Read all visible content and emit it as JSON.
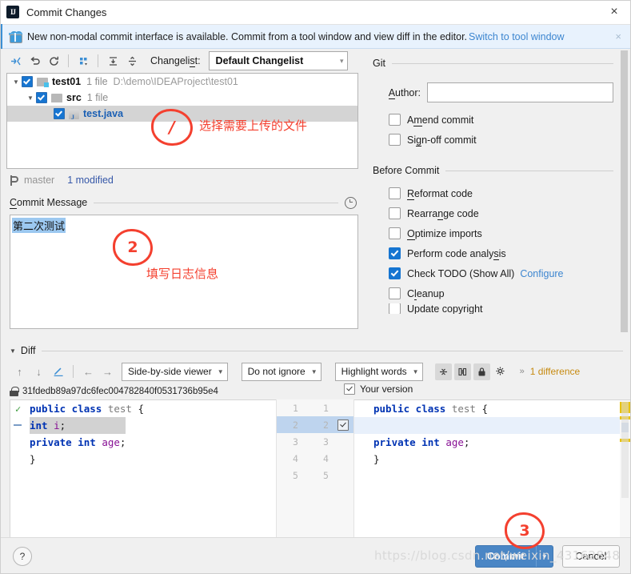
{
  "window": {
    "title": "Commit Changes",
    "close_icon": "close-icon",
    "app_icon": "intellij-idea-icon"
  },
  "notification": {
    "icon": "gift-icon",
    "text": "New non-modal commit interface is available. Commit from a tool window and view diff in the editor.",
    "link": "Switch to tool window",
    "close": "×"
  },
  "changelist_toolbar": {
    "buttons": [
      {
        "name": "show-diff-icon",
        "glyph": "⇥"
      },
      {
        "name": "revert-icon",
        "glyph": "↶"
      },
      {
        "name": "refresh-icon",
        "glyph": "↻"
      },
      {
        "name": "group-by-icon",
        "glyph": "∷"
      },
      {
        "name": "expand-all-icon",
        "glyph": "⤓"
      },
      {
        "name": "collapse-all-icon",
        "glyph": "⤒"
      }
    ],
    "changelist_label": "Changelist:",
    "changelist_value": "Default Changelist",
    "dropdown_arrow": "▾"
  },
  "file_tree": [
    {
      "name": "test01",
      "meta": "1 file",
      "path": "D:\\demo\\IDEAProject\\test01",
      "checked": true,
      "expanded": true,
      "type": "project",
      "indent": 0,
      "selected": false
    },
    {
      "name": "src",
      "meta": "1 file",
      "path": "",
      "checked": true,
      "expanded": true,
      "type": "folder",
      "indent": 1,
      "selected": false
    },
    {
      "name": "test.java",
      "meta": "",
      "path": "",
      "checked": true,
      "expanded": null,
      "type": "java",
      "indent": 2,
      "selected": true
    }
  ],
  "status": {
    "branch_icon": "branch-icon",
    "branch": "master",
    "modified": "1 modified"
  },
  "commit_message": {
    "section_label": "Commit Message",
    "history_icon": "clock-history-icon",
    "value": "第二次测试"
  },
  "git_panel": {
    "section_label": "Git",
    "author_label": "Author:",
    "author_value": "",
    "checkboxes": [
      {
        "label": "Amend commit",
        "checked": false
      },
      {
        "label": "Sign-off commit",
        "checked": false
      }
    ]
  },
  "before_commit": {
    "section_label": "Before Commit",
    "checkboxes": [
      {
        "label": "Reformat code",
        "checked": false,
        "link": ""
      },
      {
        "label": "Rearrange code",
        "checked": false,
        "link": ""
      },
      {
        "label": "Optimize imports",
        "checked": false,
        "link": ""
      },
      {
        "label": "Perform code analysis",
        "checked": true,
        "link": ""
      },
      {
        "label": "Check TODO (Show All)",
        "checked": true,
        "link": "Configure"
      },
      {
        "label": "Cleanup",
        "checked": false,
        "link": ""
      },
      {
        "label": "Update copyright",
        "checked": false,
        "link": ""
      }
    ]
  },
  "diff": {
    "section_label": "Diff",
    "toolbar": {
      "prev_diff": "↑",
      "next_diff": "↓",
      "edit_icon": "pencil-icon",
      "apply_left": "←",
      "apply_right": "→",
      "viewer_mode": "Side-by-side viewer",
      "ignore_mode": "Do not ignore",
      "highlight_mode": "Highlight words",
      "collapse_icon": "collapse-unchanged-icon",
      "sync_icon": "sync-scroll-icon",
      "lock_icon": "read-only-icon",
      "settings_icon": "gear-icon",
      "overflow": "»",
      "difference_count": "1 difference"
    },
    "revision": {
      "lock_icon": "lock-icon",
      "hash": "31fdedb89a97dc6fec004782840f0531736b95e4"
    },
    "your_version": {
      "label": "Your version",
      "checked": true
    },
    "left_lines": [
      {
        "text": "public class test {",
        "state": "unchanged"
      },
      {
        "text": "    int i;",
        "state": "removed"
      },
      {
        "text": "    private int age;",
        "state": "unchanged"
      },
      {
        "text": "}",
        "state": "unchanged"
      }
    ],
    "right_lines": [
      {
        "text": "public class test {",
        "state": "unchanged"
      },
      {
        "text": "",
        "state": "empty"
      },
      {
        "text": "    private int age;",
        "state": "unchanged"
      },
      {
        "text": "}",
        "state": "unchanged"
      }
    ],
    "line_numbers_left": [
      "1",
      "2",
      "3",
      "4",
      "5"
    ],
    "line_numbers_right": [
      "1",
      "2",
      "3",
      "4",
      "5"
    ],
    "accepted_change_row": 2
  },
  "footer": {
    "help_label": "?",
    "commit_label": "Commit",
    "commit_dropdown": "▾",
    "cancel_label": "Cancel"
  },
  "annotations": [
    {
      "marker": "1",
      "text": "选择需要上传的文件"
    },
    {
      "marker": "2",
      "text": "填写日志信息"
    },
    {
      "marker": "3",
      "text": ""
    }
  ],
  "watermark": "https://blog.csdn.net/weixin_43162848",
  "colors": {
    "accent": "#4a86c5",
    "link": "#3d86d0",
    "annotation": "#f4402f",
    "diff_count": "#c68a10"
  }
}
